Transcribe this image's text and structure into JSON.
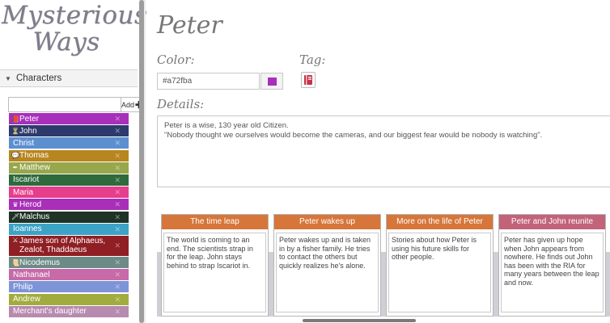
{
  "app": {
    "title_line1": "Mysterious",
    "title_line2": "Ways"
  },
  "sidebar": {
    "panel_label": "Characters",
    "add_input_value": "",
    "add_button_label": "Add",
    "characters": [
      {
        "name": "Peter",
        "color": "#a72fba",
        "tag": "book"
      },
      {
        "name": "John",
        "color": "#2d3b6c",
        "tag": "hourglass"
      },
      {
        "name": "Christ",
        "color": "#5c8fd0",
        "tag": ""
      },
      {
        "name": "Thomas",
        "color": "#b8861e",
        "tag": "speech"
      },
      {
        "name": "Matthew",
        "color": "#98a74c",
        "tag": "pen"
      },
      {
        "name": "Iscariot",
        "color": "#2f6a3c",
        "tag": ""
      },
      {
        "name": "Maria",
        "color": "#e53e8b",
        "tag": ""
      },
      {
        "name": "Herod",
        "color": "#a92fb9",
        "tag": "crown"
      },
      {
        "name": "Malchus",
        "color": "#1e3325",
        "tag": "sword"
      },
      {
        "name": "Ioannes",
        "color": "#3ca3c7",
        "tag": ""
      },
      {
        "name": "James son of Alphaeus, Zealot, Thaddaeus",
        "color": "#8f1f24",
        "tag": "swords"
      },
      {
        "name": "Nicodemus",
        "color": "#6c8b86",
        "tag": "scroll"
      },
      {
        "name": "Nathanael",
        "color": "#c66aa8",
        "tag": ""
      },
      {
        "name": "Philip",
        "color": "#7d94d8",
        "tag": ""
      },
      {
        "name": "Andrew",
        "color": "#a2ac3e",
        "tag": ""
      },
      {
        "name": "Merchant's daughter",
        "color": "#b78ab0",
        "tag": ""
      }
    ]
  },
  "character": {
    "name": "Peter",
    "color_label": "Color:",
    "color_value": "#a72fba",
    "tag_label": "Tag:",
    "tag_icon": "book-icon",
    "details_label": "Details:",
    "details_line1": "Peter is a wise, 130 year old Citizen.",
    "details_line2": "\"Nobody thought we ourselves would become the cameras, and our biggest fear would be nobody is watching\"."
  },
  "timeline": {
    "cards": [
      {
        "title": "The time leap",
        "color": "#d6763a",
        "body": "The world is coming to an end. The scientists strap in for the leap. John stays behind to strap Iscariot in."
      },
      {
        "title": "Peter wakes up",
        "color": "#d6763a",
        "body": "Peter wakes up and is taken in by a fisher family. He tries to contact the others but quickly realizes he's alone."
      },
      {
        "title": "More on the life of Peter",
        "color": "#d6763a",
        "body": "Stories about how Peter is using his future skills for other people."
      },
      {
        "title": "Peter and John reunite",
        "color": "#c2637a",
        "body": "Peter has given up hope when John appears from nowhere. He finds out John has been with the RIA for many years between the leap and now."
      }
    ]
  }
}
